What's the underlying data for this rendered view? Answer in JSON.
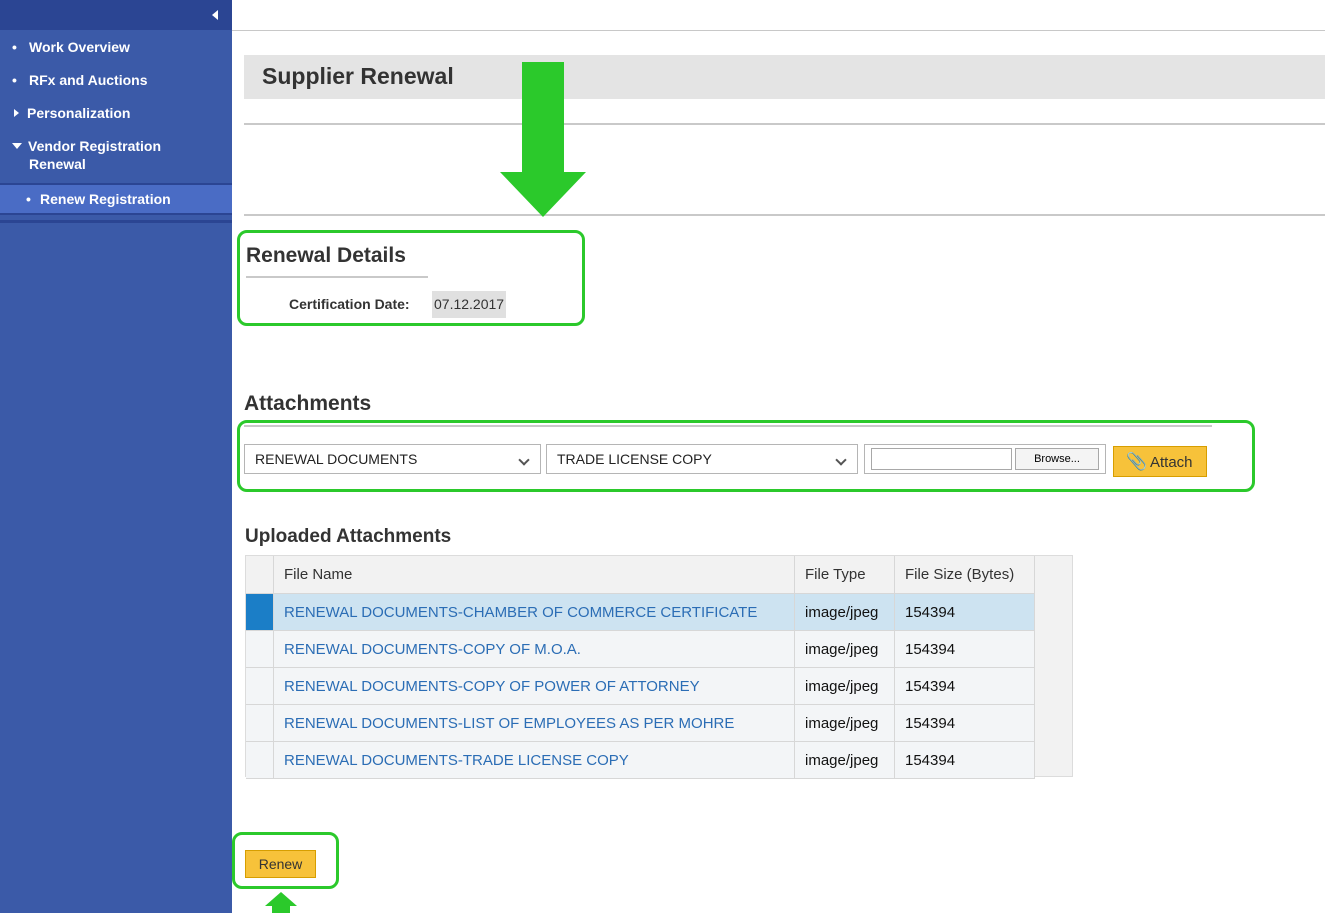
{
  "sidebar": {
    "items": [
      {
        "label": "Work Overview"
      },
      {
        "label": "RFx and Auctions"
      },
      {
        "label": "Personalization"
      },
      {
        "label": "Vendor Registration",
        "label2": "Renewal"
      },
      {
        "label": "Renew Registration"
      }
    ]
  },
  "page": {
    "title": "Supplier Renewal"
  },
  "renewal": {
    "title": "Renewal Details",
    "cert_label": "Certification Date:",
    "cert_value": "07.12.2017"
  },
  "attachments": {
    "title": "Attachments",
    "category_value": "RENEWAL DOCUMENTS",
    "doctype_value": "TRADE LICENSE COPY",
    "browse_label": "Browse...",
    "attach_label": "Attach"
  },
  "uploaded": {
    "title": "Uploaded Attachments",
    "columns": [
      "File Name",
      "File Type",
      "File Size (Bytes)"
    ],
    "rows": [
      {
        "name": "RENEWAL DOCUMENTS-CHAMBER OF COMMERCE CERTIFICATE",
        "type": "image/jpeg",
        "size": "154394"
      },
      {
        "name": "RENEWAL DOCUMENTS-COPY OF M.O.A.",
        "type": "image/jpeg",
        "size": "154394"
      },
      {
        "name": "RENEWAL DOCUMENTS-COPY OF POWER OF ATTORNEY",
        "type": "image/jpeg",
        "size": "154394"
      },
      {
        "name": "RENEWAL DOCUMENTS-LIST OF EMPLOYEES AS PER MOHRE",
        "type": "image/jpeg",
        "size": "154394"
      },
      {
        "name": "RENEWAL DOCUMENTS-TRADE LICENSE COPY",
        "type": "image/jpeg",
        "size": "154394"
      }
    ]
  },
  "actions": {
    "renew_label": "Renew"
  },
  "colors": {
    "sidebar": "#3b5aa8",
    "accent_button": "#f7c23a",
    "annotation": "#2bc92b",
    "link": "#2b6db5"
  }
}
